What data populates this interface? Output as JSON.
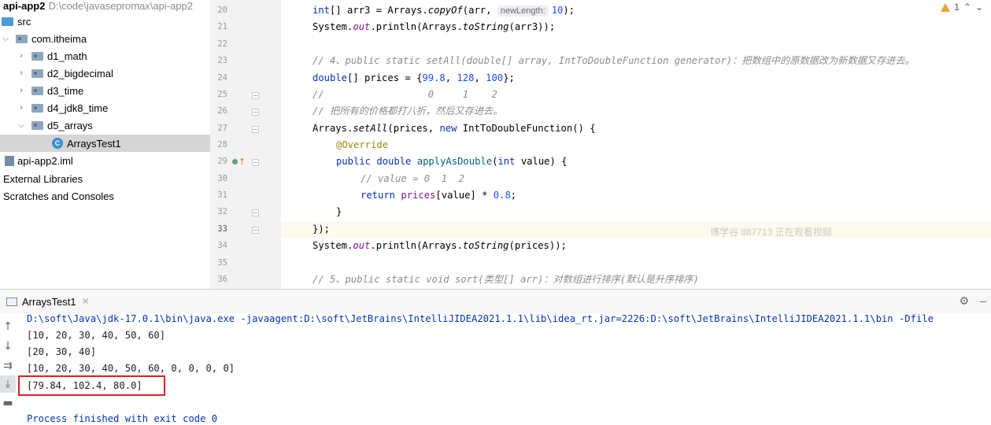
{
  "project": {
    "name": "api-app2",
    "path": "D:\\code\\javasepromax\\api-app2",
    "items": [
      {
        "label": "src",
        "icon": "source-folder-icon"
      },
      {
        "label": "com.itheima",
        "icon": "package-icon"
      },
      {
        "label": "d1_math",
        "icon": "package-icon"
      },
      {
        "label": "d2_bigdecimal",
        "icon": "package-icon"
      },
      {
        "label": "d3_time",
        "icon": "package-icon"
      },
      {
        "label": "d4_jdk8_time",
        "icon": "package-icon"
      },
      {
        "label": "d5_arrays",
        "icon": "package-icon"
      },
      {
        "label": "ArraysTest1",
        "icon": "java-class-icon"
      },
      {
        "label": "api-app2.iml",
        "icon": "module-file-icon"
      },
      {
        "label": "External Libraries",
        "icon": "library-icon"
      },
      {
        "label": "Scratches and Consoles",
        "icon": "scratch-icon"
      }
    ]
  },
  "editor": {
    "line_numbers": [
      "20",
      "21",
      "22",
      "23",
      "24",
      "25",
      "26",
      "27",
      "28",
      "29",
      "30",
      "31",
      "32",
      "33",
      "34",
      "35",
      "36"
    ],
    "current_line": "33",
    "warning_count": "1",
    "inlay_hint": "newLength:",
    "watermark": "博学谷 887713 正在观看视频",
    "code": {
      "l20_a": "int",
      "l20_b": "[] arr3 = Arrays.",
      "l20_c": "copyOf",
      "l20_d": "(arr, ",
      "l20_e": "10",
      "l20_f": ");",
      "l21_a": "System.",
      "l21_b": "out",
      "l21_c": ".println(Arrays.",
      "l21_d": "toString",
      "l21_e": "(arr3));",
      "l23": "// 4、public static setAll(double[] array, IntToDoubleFunction generator)：把数组中的原数据改为新数据又存进去。",
      "l24_a": "double",
      "l24_b": "[] prices = {",
      "l24_c": "99.8",
      "l24_d": ", ",
      "l24_e": "128",
      "l24_f": ", ",
      "l24_g": "100",
      "l24_h": "};",
      "l25": "//                  0     1    2",
      "l26": "// 把所有的价格都打八折，然后又存进去。",
      "l27_a": "Arrays.",
      "l27_b": "setAll",
      "l27_c": "(prices, ",
      "l27_d": "new",
      "l27_e": " IntToDoubleFunction() {",
      "l28": "@Override",
      "l29_a": "public double",
      "l29_b": " ",
      "l29_c": "applyAsDouble",
      "l29_d": "(",
      "l29_e": "int",
      "l29_f": " value) {",
      "l30": "// value = 0  1  2",
      "l31_a": "return",
      "l31_b": " ",
      "l31_c": "prices",
      "l31_d": "[value] * ",
      "l31_e": "0.8",
      "l31_f": ";",
      "l32": "}",
      "l33": "});",
      "l34_a": "System.",
      "l34_b": "out",
      "l34_c": ".println(Arrays.",
      "l34_d": "toString",
      "l34_e": "(prices));",
      "l36": "// 5、public static void sort(类型[] arr)：对数组进行排序(默认是升序排序)"
    }
  },
  "run": {
    "tab_label": "ArraysTest1",
    "command": "D:\\soft\\Java\\jdk-17.0.1\\bin\\java.exe -javaagent:D:\\soft\\JetBrains\\IntelliJIDEA2021.1.1\\lib\\idea_rt.jar=2226:D:\\soft\\JetBrains\\IntelliJIDEA2021.1.1\\bin -Dfile",
    "output": [
      "[10, 20, 30, 40, 50, 60]",
      "[20, 30, 40]",
      "[10, 20, 30, 40, 50, 60, 0, 0, 0, 0]",
      "[79.84, 102.4, 80.0]"
    ],
    "exit_message": "Process finished with exit code 0"
  },
  "colors": {
    "keyword": "#0033b3",
    "number": "#1750eb",
    "comment": "#8c8c8c",
    "highlight_box": "#e02020",
    "warning": "#e8a33d"
  }
}
